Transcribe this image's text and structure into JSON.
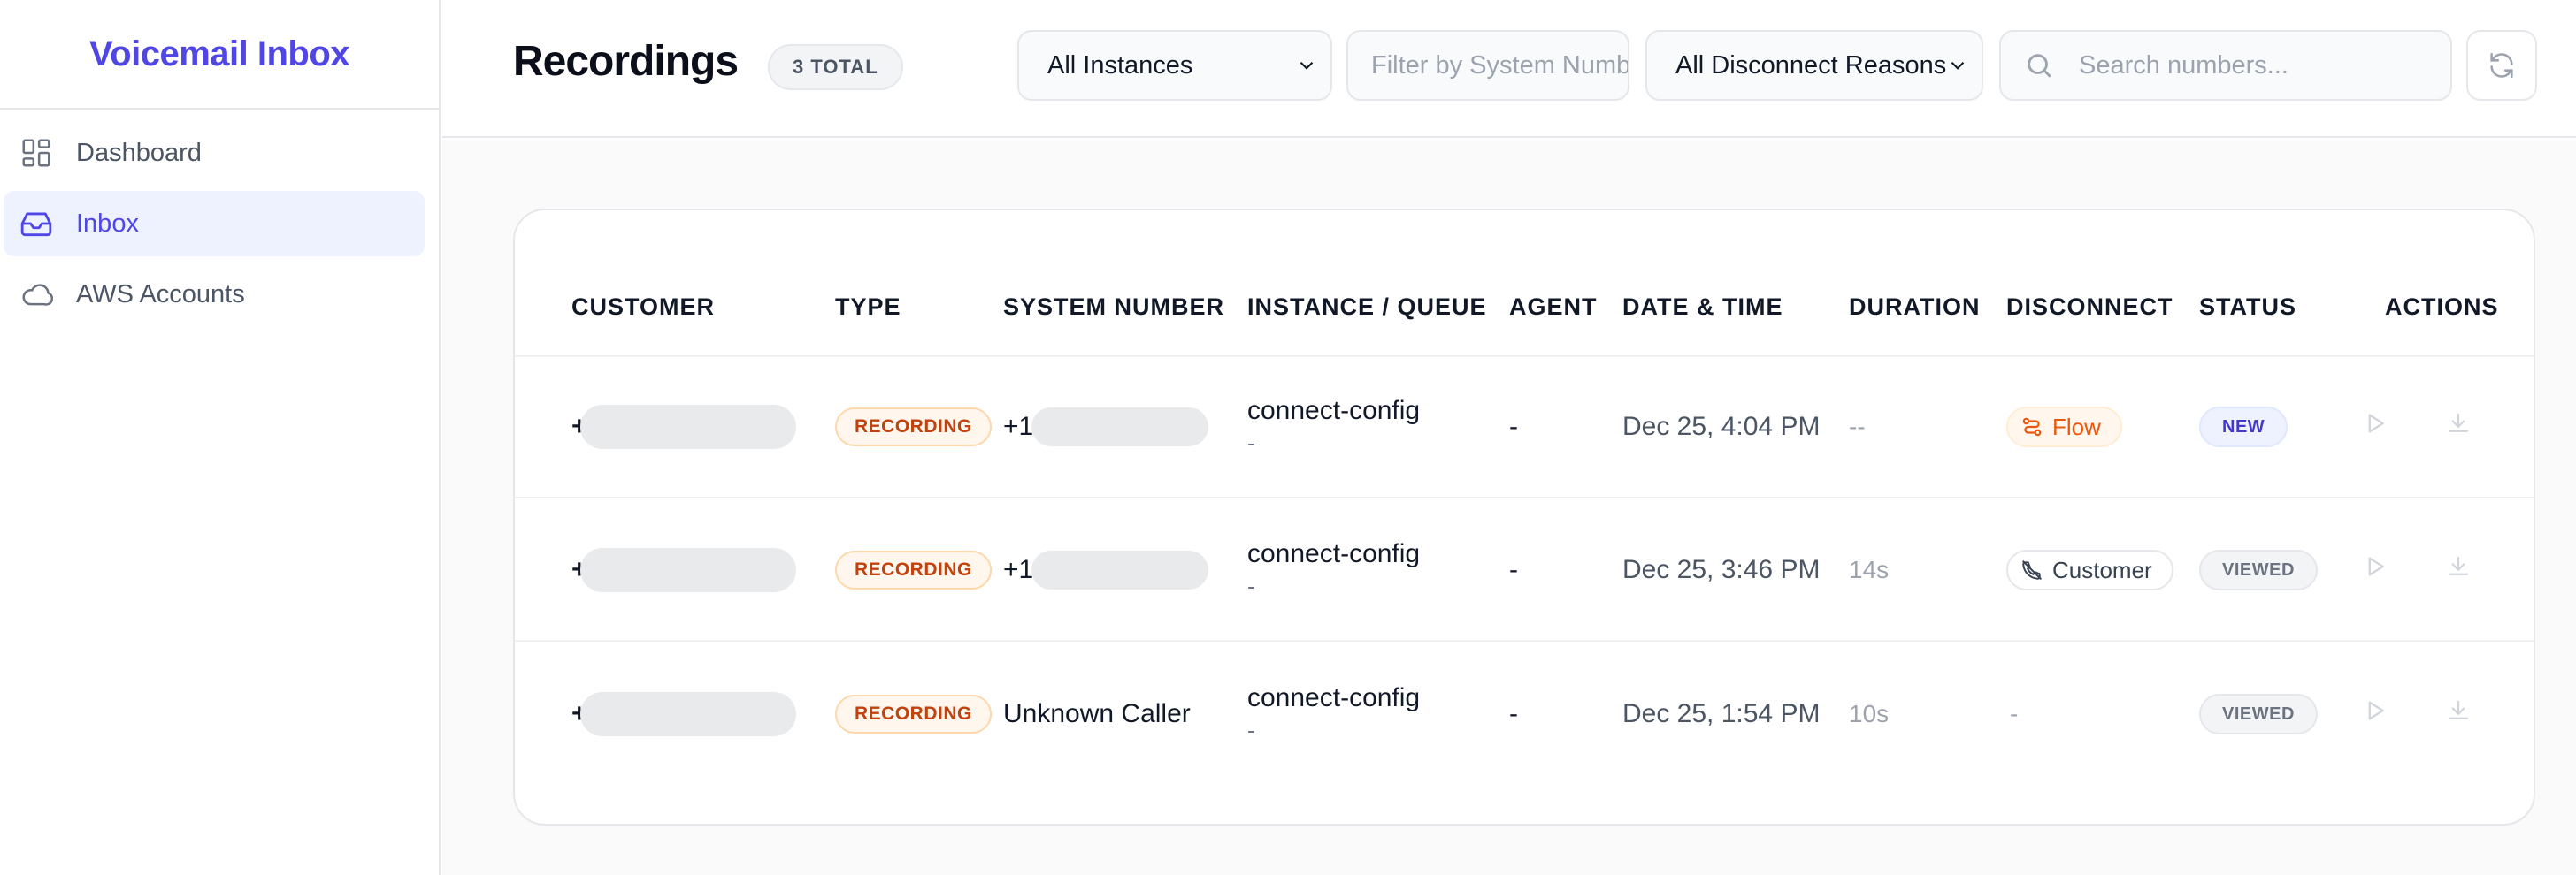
{
  "sidebar": {
    "brand": "Voicemail Inbox",
    "items": [
      {
        "label": "Dashboard",
        "icon": "dashboard-grid-icon",
        "active": false
      },
      {
        "label": "Inbox",
        "icon": "inbox-icon",
        "active": true
      },
      {
        "label": "AWS Accounts",
        "icon": "cloud-icon",
        "active": false
      }
    ]
  },
  "header": {
    "title": "Recordings",
    "total_badge": "3 TOTAL",
    "instance_select": "All Instances",
    "system_number_placeholder": "Filter by System Number",
    "disconnect_select": "All Disconnect Reasons",
    "search_placeholder": "Search numbers..."
  },
  "table": {
    "columns": [
      "CUSTOMER",
      "TYPE",
      "SYSTEM NUMBER",
      "INSTANCE / QUEUE",
      "AGENT",
      "DATE & TIME",
      "DURATION",
      "DISCONNECT",
      "STATUS",
      "ACTIONS"
    ],
    "rows": [
      {
        "customer": "+",
        "type": "RECORDING",
        "system_number": "+1",
        "instance": "connect-config",
        "queue": "-",
        "agent": "-",
        "datetime": "Dec 25, 4:04 PM",
        "duration": "--",
        "disconnect": "Flow",
        "status": "NEW"
      },
      {
        "customer": "+",
        "type": "RECORDING",
        "system_number": "+1",
        "instance": "connect-config",
        "queue": "-",
        "agent": "-",
        "datetime": "Dec 25, 3:46 PM",
        "duration": "14s",
        "disconnect": "Customer",
        "status": "VIEWED"
      },
      {
        "customer": "+",
        "type": "RECORDING",
        "system_number": "Unknown Caller",
        "instance": "connect-config",
        "queue": "-",
        "agent": "-",
        "datetime": "Dec 25, 1:54 PM",
        "duration": "10s",
        "disconnect": "-",
        "status": "VIEWED"
      }
    ]
  },
  "colors": {
    "accent": "#4f46e5",
    "recording_badge": "#c2410c",
    "flow_badge": "#ea580c",
    "status_new": "#4338ca",
    "status_viewed": "#6b7280"
  }
}
